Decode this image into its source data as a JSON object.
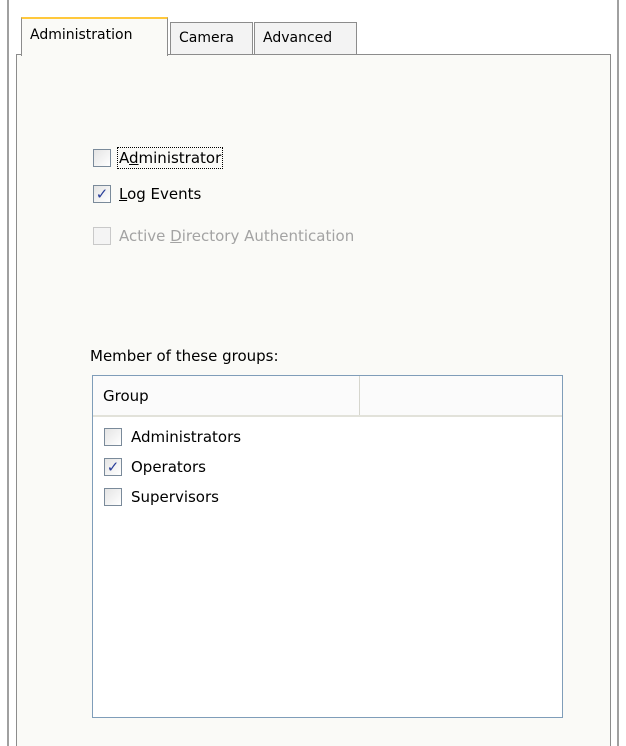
{
  "tabs": [
    {
      "label": "Administration",
      "active": true
    },
    {
      "label": "Camera",
      "active": false
    },
    {
      "label": "Advanced",
      "active": false
    }
  ],
  "options": {
    "administrator": {
      "pre": "A",
      "mnemonic": "d",
      "post": "ministrator",
      "checked": false,
      "enabled": true
    },
    "log_events": {
      "pre": "",
      "mnemonic": "L",
      "post": "og Events",
      "checked": true,
      "enabled": true
    },
    "active_directory": {
      "pre": "Active ",
      "mnemonic": "D",
      "post": "irectory Authentication",
      "checked": false,
      "enabled": false
    }
  },
  "groups": {
    "caption": "Member of these groups:",
    "column_header": "Group",
    "items": [
      {
        "label": "Administrators",
        "checked": false
      },
      {
        "label": "Operators",
        "checked": true
      },
      {
        "label": "Supervisors",
        "checked": false
      }
    ]
  },
  "icons": {
    "check_mark": "check-icon"
  },
  "colors": {
    "active_tab_accent": "#ffc83c",
    "check_mark": "#2a3f9a",
    "disabled_text": "#a3a3a3",
    "list_border": "#7f9db9"
  }
}
